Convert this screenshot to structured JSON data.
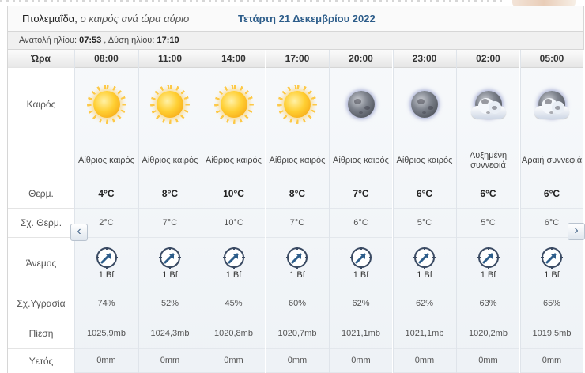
{
  "header": {
    "location": "Πτολεμαΐδα,",
    "subtitle": "ο καιρός ανά ώρα αύριο",
    "date": "Τετάρτη 21 Δεκεμβρίου 2022"
  },
  "sun": {
    "sunrise_label": "Ανατολή ηλίου:",
    "sunrise": "07:53",
    "sunset_label": ", Δύση ηλίου:",
    "sunset": "17:10"
  },
  "labels": {
    "time": "Ώρα",
    "weather": "Καιρός",
    "temp": "Θερμ.",
    "feels": "Σχ. Θερμ.",
    "wind": "Άνεμος",
    "humidity": "Σχ.Υγρασία",
    "pressure": "Πίεση",
    "rain": "Υετός"
  },
  "nav": {
    "prev": "‹",
    "next": "›"
  },
  "hours": [
    {
      "time": "08:00",
      "icon": "sun-icon",
      "desc": "Αίθριος καιρός",
      "temp": "4°C",
      "feels": "2°C",
      "wind": "1 Bf",
      "humidity": "74%",
      "pressure": "1025,9mb",
      "rain": "0mm"
    },
    {
      "time": "11:00",
      "icon": "sun-icon",
      "desc": "Αίθριος καιρός",
      "temp": "8°C",
      "feels": "7°C",
      "wind": "1 Bf",
      "humidity": "52%",
      "pressure": "1024,3mb",
      "rain": "0mm"
    },
    {
      "time": "14:00",
      "icon": "sun-icon",
      "desc": "Αίθριος καιρός",
      "temp": "10°C",
      "feels": "10°C",
      "wind": "1 Bf",
      "humidity": "45%",
      "pressure": "1020,8mb",
      "rain": "0mm"
    },
    {
      "time": "17:00",
      "icon": "sun-icon",
      "desc": "Αίθριος καιρός",
      "temp": "8°C",
      "feels": "7°C",
      "wind": "1 Bf",
      "humidity": "60%",
      "pressure": "1020,7mb",
      "rain": "0mm"
    },
    {
      "time": "20:00",
      "icon": "moon-icon",
      "desc": "Αίθριος καιρός",
      "temp": "7°C",
      "feels": "6°C",
      "wind": "1 Bf",
      "humidity": "62%",
      "pressure": "1021,1mb",
      "rain": "0mm"
    },
    {
      "time": "23:00",
      "icon": "moon-icon",
      "desc": "Αίθριος καιρός",
      "temp": "6°C",
      "feels": "5°C",
      "wind": "1 Bf",
      "humidity": "62%",
      "pressure": "1021,1mb",
      "rain": "0mm"
    },
    {
      "time": "02:00",
      "icon": "moon-cloud-icon",
      "desc": "Αυξημένη συννεφιά",
      "temp": "6°C",
      "feels": "5°C",
      "wind": "1 Bf",
      "humidity": "63%",
      "pressure": "1020,2mb",
      "rain": "0mm"
    },
    {
      "time": "05:00",
      "icon": "moon-cloud-icon",
      "desc": "Αραιή συννεφιά",
      "temp": "6°C",
      "feels": "6°C",
      "wind": "1 Bf",
      "humidity": "65%",
      "pressure": "1019,5mb",
      "rain": "0mm"
    }
  ]
}
